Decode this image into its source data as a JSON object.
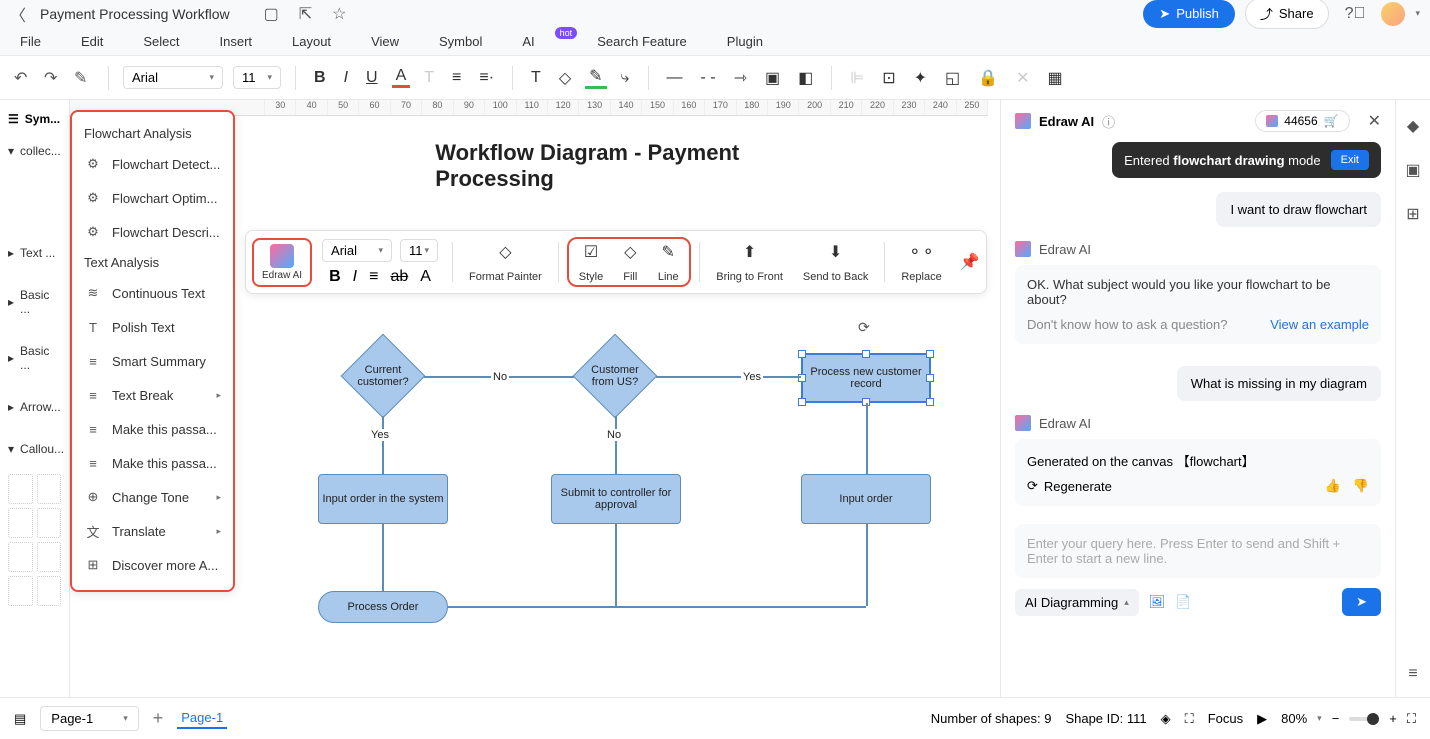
{
  "doc": {
    "title": "Payment Processing Workflow"
  },
  "topbar": {
    "publish": "Publish",
    "share": "Share"
  },
  "menubar": {
    "items": [
      "File",
      "Edit",
      "Select",
      "Insert",
      "Layout",
      "View",
      "Symbol",
      "AI",
      "Search Feature",
      "Plugin"
    ],
    "hot": "hot"
  },
  "toolbar": {
    "font": "Arial",
    "size": "11"
  },
  "left": {
    "header": "Sym...",
    "items": [
      "collec...",
      "Text ...",
      "Basic ...",
      "Basic ...",
      "Arrow...",
      "Callou..."
    ]
  },
  "ai_menu": {
    "section1": "Flowchart Analysis",
    "items1": [
      "Flowchart Detect...",
      "Flowchart Optim...",
      "Flowchart Descri..."
    ],
    "section2": "Text Analysis",
    "items2": [
      "Continuous Text",
      "Polish Text",
      "Smart Summary",
      "Text Break",
      "Make this passa...",
      "Make this passa...",
      "Change Tone",
      "Translate",
      "Discover more A..."
    ]
  },
  "float": {
    "edraw": "Edraw AI",
    "font": "Arial",
    "size": "11",
    "format_painter": "Format Painter",
    "style": "Style",
    "fill": "Fill",
    "line": "Line",
    "bring_front": "Bring to Front",
    "send_back": "Send to Back",
    "replace": "Replace"
  },
  "diagram": {
    "title": "Workflow Diagram - Payment Processing",
    "current_customer": "Current customer?",
    "customer_us": "Customer from US?",
    "process_new": "Process new customer  record",
    "input_order_system": "Input order in the system",
    "submit_controller": "Submit to controller for approval",
    "input_order": "Input order",
    "process_order": "Process Order",
    "yes": "Yes",
    "no": "No"
  },
  "ai_panel": {
    "title": "Edraw AI",
    "credits": "44656",
    "mode_prefix": "Entered ",
    "mode_bold": "flowchart drawing",
    "mode_suffix": " mode",
    "exit": "Exit",
    "user1": "I want to draw flowchart",
    "ai_name": "Edraw AI",
    "response1": "OK. What subject would you like your flowchart to be about?",
    "hint": "Don't know how to ask a question?",
    "example": "View an example",
    "user2": "What is missing in my diagram",
    "generated": "Generated on the canvas 【flowchart】",
    "regenerate": "Regenerate",
    "placeholder": "Enter your query here. Press Enter to send and Shift + Enter to start a new line.",
    "mode_select": "AI Diagramming"
  },
  "bottom": {
    "page_select": "Page-1",
    "page_tab": "Page-1",
    "shapes": "Number of shapes: 9",
    "shape_id": "Shape ID: 111",
    "focus": "Focus",
    "zoom": "80%"
  },
  "ruler_h": [
    "30",
    "40",
    "50",
    "60",
    "70",
    "80",
    "90",
    "100",
    "110",
    "120",
    "130",
    "140",
    "150",
    "160",
    "170",
    "180",
    "190",
    "200",
    "210",
    "220",
    "230",
    "240",
    "250"
  ]
}
